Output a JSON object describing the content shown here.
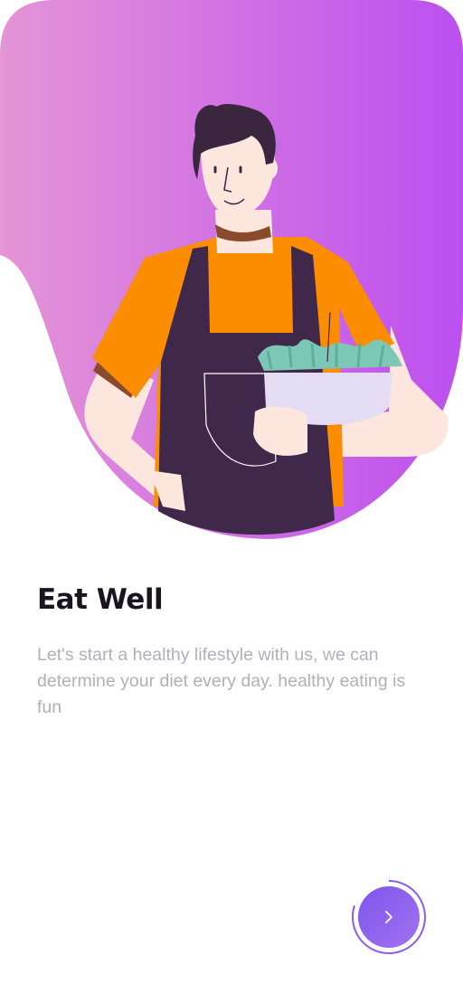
{
  "onboarding": {
    "title": "Eat Well",
    "description": "Let's start a healthy lifestyle with us, we can determine your diet every day. healthy eating is fun",
    "illustration": "chef-holding-salad-bowl",
    "next_icon": "chevron-right-icon",
    "progress": 0.8
  },
  "colors": {
    "gradient_start": "#e595d6",
    "gradient_end": "#bc4ff0",
    "accent": "#8b5cf0",
    "title_text": "#1b1320",
    "body_text": "#b4aebb"
  }
}
